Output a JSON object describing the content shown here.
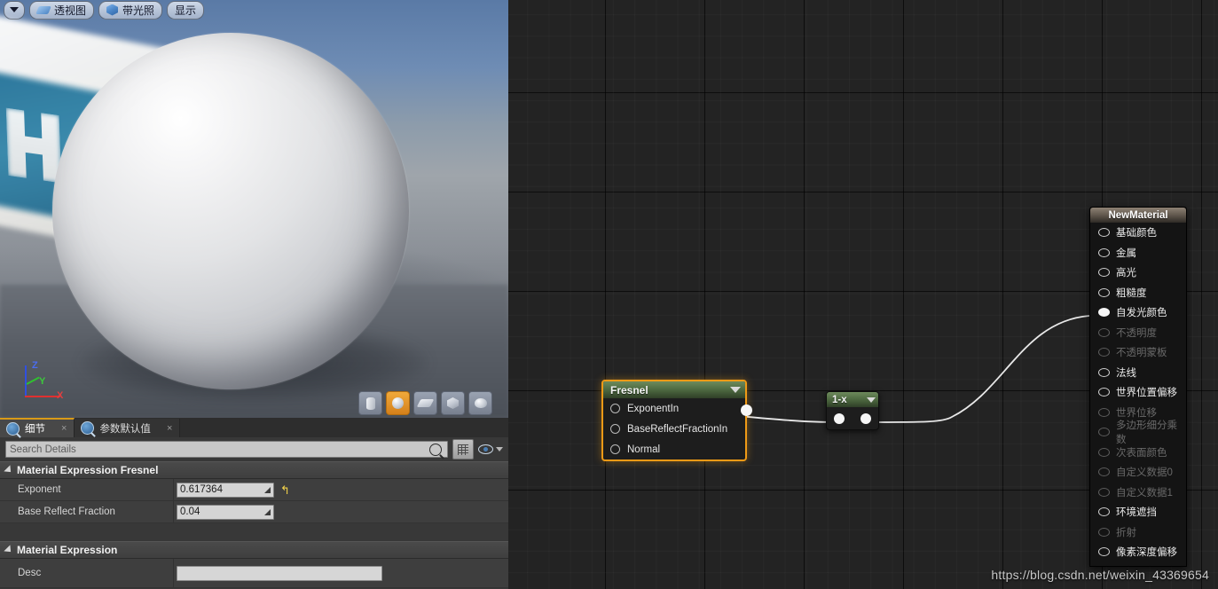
{
  "viewport": {
    "toolbar": [
      {
        "name": "view-menu-arrow",
        "label": "",
        "icon": "chevron-down-icon"
      },
      {
        "name": "perspective",
        "label": "透视图",
        "icon": "perspective-icon"
      },
      {
        "name": "lit",
        "label": "带光照",
        "icon": "cube-icon"
      },
      {
        "name": "show",
        "label": "显示",
        "icon": ""
      }
    ],
    "axis": {
      "x": "X",
      "y": "Y",
      "z": "Z",
      "x_color": "#e03030",
      "y_color": "#30c030",
      "z_color": "#3050e0"
    },
    "shapes": [
      {
        "name": "cylinder",
        "active": false
      },
      {
        "name": "sphere",
        "active": true
      },
      {
        "name": "plane",
        "active": false
      },
      {
        "name": "cube",
        "active": false
      },
      {
        "name": "teapot",
        "active": false
      }
    ]
  },
  "details": {
    "tabs": [
      {
        "label": "细节",
        "active": true,
        "icon": "details-icon",
        "close": "×"
      },
      {
        "label": "参数默认值",
        "active": false,
        "icon": "details-icon",
        "close": "×"
      }
    ],
    "search_placeholder": "Search Details",
    "search_value": "",
    "toolbar": {
      "grid_icon": "grid-view-icon",
      "eye_icon": "eye-icon",
      "search_icon": "search-icon"
    },
    "sections": [
      {
        "title": "Material Expression Fresnel",
        "rows": [
          {
            "name": "Exponent",
            "value": "0.617364",
            "type": "number",
            "reset": true,
            "reset_glyph": "↰"
          },
          {
            "name": "Base Reflect Fraction",
            "value": "0.04",
            "type": "number",
            "reset": false
          }
        ]
      },
      {
        "title": "Material Expression",
        "rows": [
          {
            "name": "Desc",
            "value": "",
            "type": "text",
            "reset": false
          }
        ]
      }
    ]
  },
  "graph": {
    "nodes": [
      {
        "id": "fresnel",
        "title": "Fresnel",
        "selected": true,
        "inputs": [
          {
            "label": "ExponentIn",
            "connected": false
          },
          {
            "label": "BaseReflectFractionIn",
            "connected": false
          },
          {
            "label": "Normal",
            "connected": false
          }
        ],
        "output": {
          "connected": true
        }
      },
      {
        "id": "oneminus",
        "title": "1-x",
        "selected": false,
        "input": {
          "connected": true
        },
        "output": {
          "connected": true
        }
      }
    ],
    "material_node": {
      "title": "NewMaterial",
      "pins": [
        {
          "label": "基础颜色",
          "enabled": true,
          "connected": false
        },
        {
          "label": "金属",
          "enabled": true,
          "connected": false
        },
        {
          "label": "高光",
          "enabled": true,
          "connected": false
        },
        {
          "label": "粗糙度",
          "enabled": true,
          "connected": false
        },
        {
          "label": "自发光颜色",
          "enabled": true,
          "connected": true
        },
        {
          "label": "不透明度",
          "enabled": false,
          "connected": false
        },
        {
          "label": "不透明蒙板",
          "enabled": false,
          "connected": false
        },
        {
          "label": "法线",
          "enabled": true,
          "connected": false
        },
        {
          "label": "世界位置偏移",
          "enabled": true,
          "connected": false
        },
        {
          "label": "世界位移",
          "enabled": false,
          "connected": false
        },
        {
          "label": "多边形细分乘数",
          "enabled": false,
          "connected": false
        },
        {
          "label": "次表面颜色",
          "enabled": false,
          "connected": false
        },
        {
          "label": "自定义数据0",
          "enabled": false,
          "connected": false
        },
        {
          "label": "自定义数据1",
          "enabled": false,
          "connected": false
        },
        {
          "label": "环境遮挡",
          "enabled": true,
          "connected": false
        },
        {
          "label": "折射",
          "enabled": false,
          "connected": false
        },
        {
          "label": "像素深度偏移",
          "enabled": true,
          "connected": false
        }
      ]
    }
  },
  "watermark": "https://blog.csdn.net/weixin_43369654"
}
